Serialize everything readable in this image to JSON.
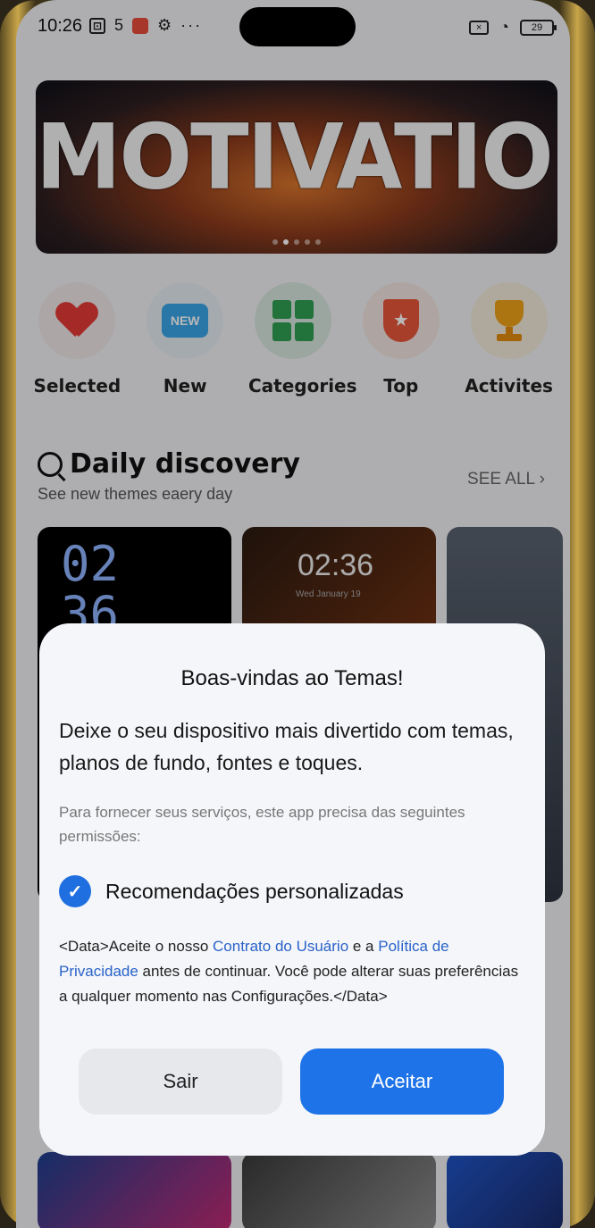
{
  "status_bar": {
    "time": "10:26",
    "icons": [
      "screen-record-icon",
      "sim-icon",
      "app-notification-icon",
      "gear-icon",
      "more-icon"
    ],
    "battery": "29"
  },
  "banner": {
    "title": "MOTIVATION",
    "dots": 5,
    "active_dot": 1
  },
  "categories": [
    {
      "label": "Selected",
      "icon": "heart-icon",
      "bg": "#efe7e8"
    },
    {
      "label": "New",
      "icon": "new-badge-icon",
      "bg": "#e5ecf2"
    },
    {
      "label": "Categories",
      "icon": "grid-icon",
      "bg": "#d9e7de"
    },
    {
      "label": "Top",
      "icon": "ribbon-badge-icon",
      "bg": "#f1e4df"
    },
    {
      "label": "Activites",
      "icon": "trophy-icon",
      "bg": "#f1ead9"
    }
  ],
  "daily_discovery": {
    "title": "Daily discovery",
    "subtitle": "See new themes eaery day",
    "see_all": "SEE ALL",
    "thumbs": [
      {
        "clock": "02\n36"
      },
      {
        "clock": "02:36",
        "sub": "Wed  January 19"
      },
      {
        "clock": ""
      }
    ]
  },
  "dialog": {
    "title": "Boas-vindas ao Temas!",
    "body": "Deixe o seu dispositivo mais divertido com temas, planos de fundo, fontes e toques.",
    "note": "Para fornecer seus serviços, este app precisa das seguintes permissões:",
    "permission_label": "Recomendações personalizadas",
    "permission_checked": true,
    "legal_prefix": "<Data>Aceite o nosso ",
    "legal_link1": "Contrato do Usuário",
    "legal_mid": " e a ",
    "legal_link2": "Política de Privacidade",
    "legal_suffix": " antes de continuar. Você pode alterar suas preferências a qualquer momento nas Configurações.</Data>",
    "cancel_label": "Sair",
    "accept_label": "Aceitar",
    "accent_color": "#1f73e8"
  }
}
